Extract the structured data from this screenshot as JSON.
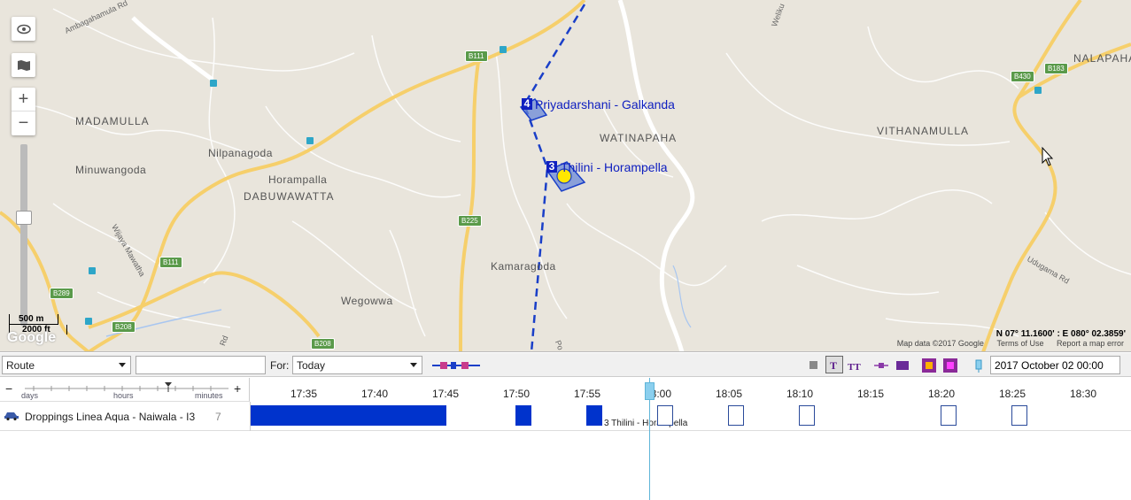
{
  "map": {
    "places": {
      "madamulla": "MADAMULLA",
      "minuwangoda": "Minuwangoda",
      "nilpanagoda": "Nilpanagoda",
      "horampalla": "Horampalla",
      "dabuwawatta": "DABUWAWATTA",
      "watinapaha": "WATINAPAHA",
      "vithanamulla": "VITHANAMULLA",
      "nalapaha": "NALAPAHA",
      "kamaragoda": "Kamaragoda",
      "wegowwa": "Wegowwa"
    },
    "roads": {
      "ambagahamula": "Ambagahamula Rd",
      "wijaya": "Wijaya Mawatha",
      "udugama": "Udugama Rd",
      "weliku": "Weliku",
      "rd_small": "Rd",
      "po": "Po"
    },
    "shields": {
      "b111_top": "B111",
      "b111_bottom": "B111",
      "b225": "B225",
      "b289": "B289",
      "b208_left": "B208",
      "b208_bottom": "B208",
      "b430": "B430",
      "b183": "B183"
    },
    "geofences": [
      {
        "num": "4",
        "label": "Priyadarshani - Galkanda"
      },
      {
        "num": "3",
        "label": "Thilini - Horampella"
      }
    ],
    "scale_m": "500 m",
    "scale_ft": "2000 ft",
    "coords": "N 07° 11.1600' : E 080° 02.3859'",
    "google": "Google",
    "attribution": {
      "data": "Map data ©2017 Google",
      "terms": "Terms of Use",
      "report": "Report a map error"
    },
    "colors": {
      "geofence": "#1020c0",
      "route": "#1a3fc8",
      "marker": "#ffe600"
    }
  },
  "toolbar": {
    "view_select": "Route",
    "search_value": "",
    "for_label": "For:",
    "period_select": "Today",
    "datetime_value": "2017 October 02 00:00"
  },
  "timeline": {
    "scale_labels": {
      "days": "days",
      "hours": "hours",
      "minutes": "minutes"
    },
    "minus": "−",
    "plus": "+",
    "ticks": [
      "17:35",
      "17:40",
      "17:45",
      "17:50",
      "17:55",
      "18:00",
      "18:05",
      "18:10",
      "18:15",
      "18:20",
      "18:25",
      "18:30"
    ],
    "row": {
      "name": "Droppings Linea Aqua - Naiwala - I3",
      "count": "7",
      "bar_label": "3 Thilini - Horampella"
    }
  }
}
